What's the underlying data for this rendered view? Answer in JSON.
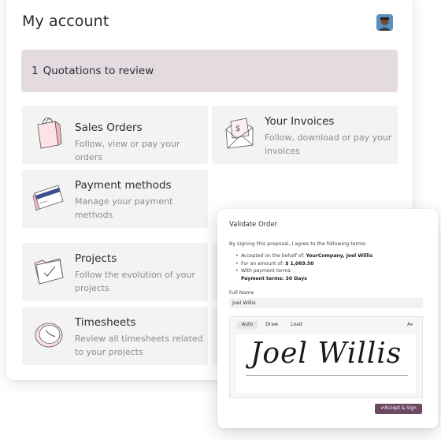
{
  "page": {
    "title": "My account"
  },
  "quotations": {
    "count": "1",
    "label": "Quotations to review"
  },
  "tiles": {
    "sales_orders": {
      "title": "Sales Orders",
      "desc": "Follow, view or pay your orders"
    },
    "invoices": {
      "title": "Your Invoices",
      "desc_1": "Follow, download or pay your",
      "desc_2": "invoices"
    },
    "payment_methods": {
      "title": "Payment methods",
      "desc_1": "Manage your payment",
      "desc_2": "methods"
    },
    "projects": {
      "title": "Projects",
      "desc_1": "Follow the evolution of your",
      "desc_2": "projects"
    },
    "timesheets": {
      "title": "Timesheets",
      "desc_1": "Review all timesheets related",
      "desc_2": "to your projects"
    }
  },
  "modal": {
    "title": "Validate Order",
    "intro": "By signing this proposal, I agree to the following terms:",
    "terms": {
      "behalf_label": "Accepted on the behalf of:",
      "behalf_value": "YourCompany, Joel Willis",
      "amount_label": "For an amount of:",
      "amount_value": "$ 1,069.50",
      "payment_label": "With payment terms:",
      "payment_value": "Payment terms: 30 Days"
    },
    "full_name_label": "Full Name",
    "full_name_value": "Joel Willis",
    "tabs": [
      "Auto",
      "Draw",
      "Load"
    ],
    "font_icon": "A",
    "signature": "Joel Willis",
    "accept_label": "✔Accept & Sign"
  },
  "icons": {
    "shopping_bag": "shopping-bag-icon",
    "invoice_envelope": "invoice-envelope-icon",
    "credit_card": "credit-card-icon",
    "folder_check": "folder-check-icon",
    "clock": "clock-icon",
    "avatar": "user-avatar"
  },
  "colors": {
    "banner_bg": "#e3dbe0",
    "tile_bg": "#f3f3f4",
    "accept_button": "#6b4a62",
    "icon_accent": "#f0b8c0"
  }
}
